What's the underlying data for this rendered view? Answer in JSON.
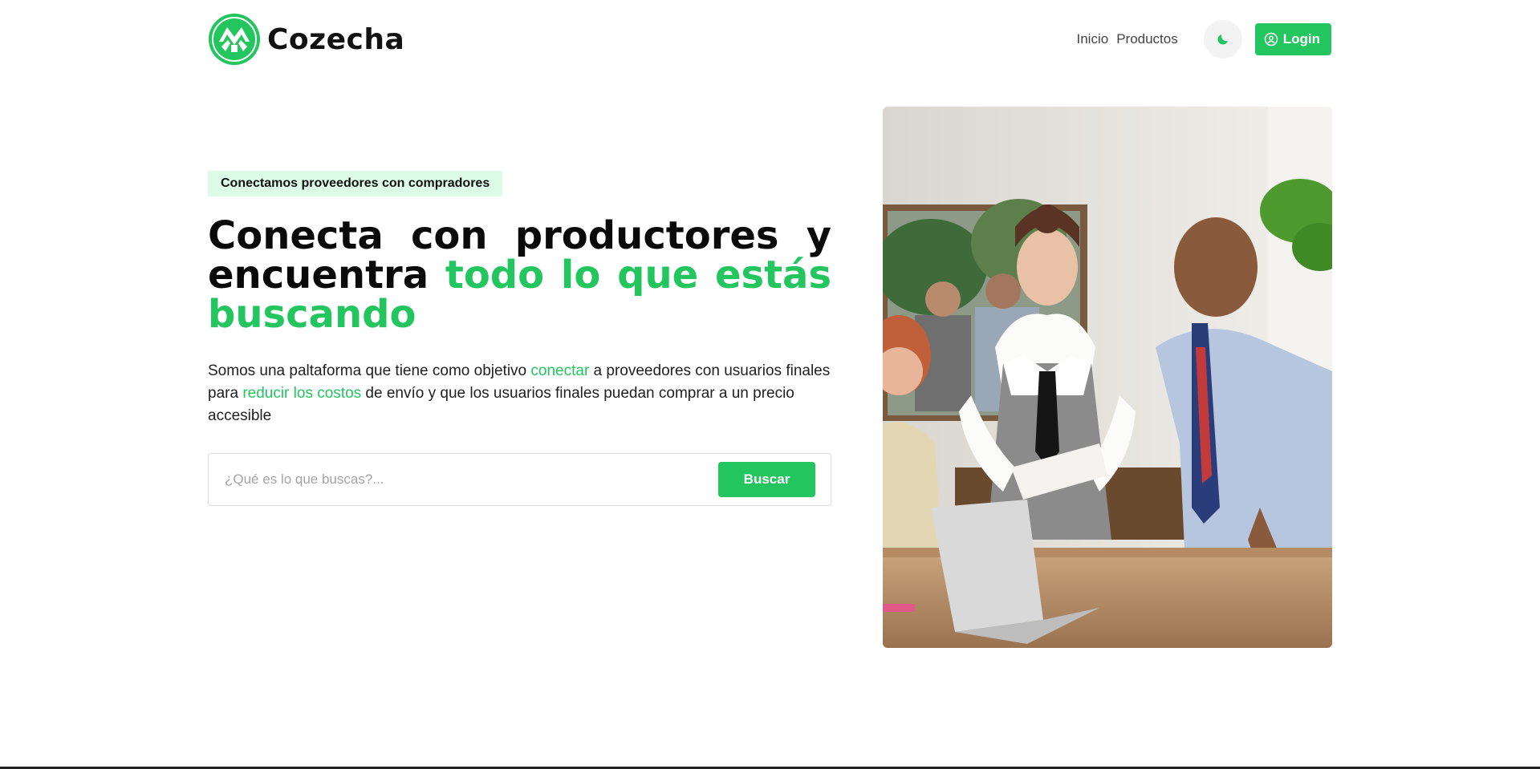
{
  "brand": {
    "name": "Cozecha",
    "color": "#22c55e"
  },
  "nav": {
    "items": [
      {
        "label": "Inicio"
      },
      {
        "label": "Productos"
      }
    ],
    "theme_icon": "moon-icon",
    "login": {
      "label": "Login",
      "icon": "user-circle-icon"
    }
  },
  "hero": {
    "tagline": "Conectamos proveedores con compradores",
    "headline": {
      "part1": "Conecta con productores y encuentra ",
      "accent": "todo lo que estás buscando"
    },
    "description": {
      "p1": "Somos una paltaforma que tiene como objetivo ",
      "hl1": "conectar",
      "p2": " a proveedores con usuarios finales para ",
      "hl2": "reducir los costos",
      "p3": " de envío y que los usuarios finales puedan comprar a un precio accesible"
    },
    "search": {
      "placeholder": "¿Qué es lo que buscas?...",
      "value": "",
      "button": "Buscar"
    }
  },
  "image": {
    "alt": "business-meeting-photo"
  }
}
